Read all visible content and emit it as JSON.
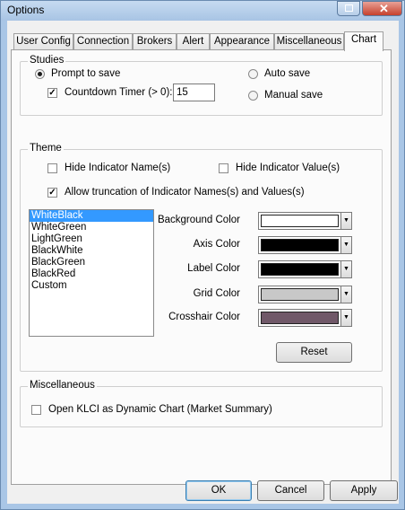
{
  "window": {
    "title": "Options",
    "restore_icon": "restore-icon",
    "close_icon": "close-icon"
  },
  "tabs": [
    {
      "label": "User Config"
    },
    {
      "label": "Connection"
    },
    {
      "label": "Brokers"
    },
    {
      "label": "Alert"
    },
    {
      "label": "Appearance"
    },
    {
      "label": "Miscellaneous"
    },
    {
      "label": "Chart",
      "active": true
    }
  ],
  "studies": {
    "title": "Studies",
    "prompt_to_save": {
      "label": "Prompt to save",
      "checked": true
    },
    "countdown_timer": {
      "label": "Countdown Timer (> 0):",
      "checked": true,
      "value": "15"
    },
    "auto_save": {
      "label": "Auto save",
      "checked": false
    },
    "manual_save": {
      "label": "Manual save",
      "checked": false
    }
  },
  "theme": {
    "title": "Theme",
    "hide_indicator_names": {
      "label": "Hide Indicator Name(s)",
      "checked": false
    },
    "hide_indicator_values": {
      "label": "Hide Indicator Value(s)",
      "checked": false
    },
    "allow_truncation": {
      "label": "Allow truncation of Indicator Names(s) and Values(s)",
      "checked": true
    },
    "themes": [
      "WhiteBlack",
      "WhiteGreen",
      "LightGreen",
      "BlackWhite",
      "BlackGreen",
      "BlackRed",
      "Custom"
    ],
    "selected_theme": "WhiteBlack",
    "colors": [
      {
        "label": "Background Color",
        "value": "#ffffff"
      },
      {
        "label": "Axis Color",
        "value": "#000000"
      },
      {
        "label": "Label Color",
        "value": "#000000"
      },
      {
        "label": "Grid Color",
        "value": "#c8c8c8"
      },
      {
        "label": "Crosshair Color",
        "value": "#705868"
      }
    ],
    "reset_label": "Reset"
  },
  "misc": {
    "title": "Miscellaneous",
    "open_klci": {
      "label": "Open KLCI as Dynamic Chart (Market Summary)",
      "checked": false
    }
  },
  "footer": {
    "ok": "OK",
    "cancel": "Cancel",
    "apply": "Apply"
  }
}
